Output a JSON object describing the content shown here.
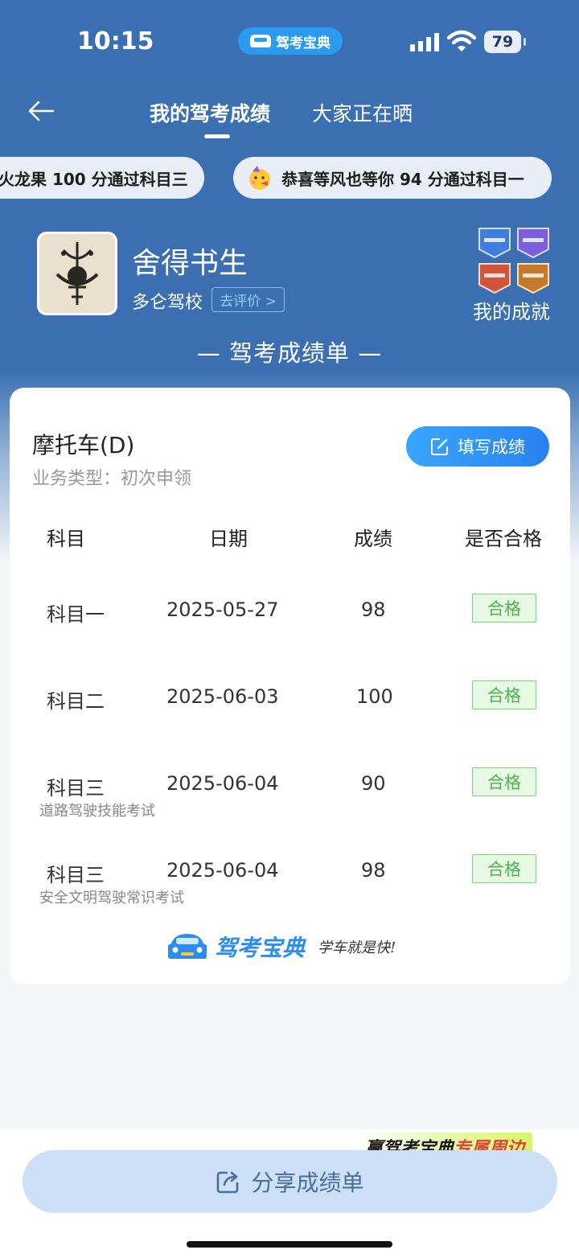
{
  "status_bar": {
    "time": "10:15",
    "app_pill": "驾考宝典",
    "battery": "79"
  },
  "nav": {
    "tabs": [
      {
        "label": "我的驾考成绩",
        "active": true
      },
      {
        "label": "大家正在晒",
        "active": false
      }
    ]
  },
  "ticker": [
    "火龙果 100 分通过科目三",
    "恭喜等风也等你 94 分通过科目一"
  ],
  "profile": {
    "username": "舍得书生",
    "school": "多仑驾校",
    "rate_label": "去评价 >",
    "achievements_label": "我的成就"
  },
  "report_title": "— 驾考成绩单 —",
  "card": {
    "vehicle": "摩托车(D)",
    "business_type": "业务类型：初次申领",
    "fill_button": "填写成绩",
    "columns": [
      "科目",
      "日期",
      "成绩",
      "是否合格"
    ],
    "rows": [
      {
        "subject": "科目一",
        "date": "2025-05-27",
        "score": "98",
        "result": "合格",
        "note": ""
      },
      {
        "subject": "科目二",
        "date": "2025-06-03",
        "score": "100",
        "result": "合格",
        "note": ""
      },
      {
        "subject": "科目三",
        "date": "2025-06-04",
        "score": "90",
        "result": "合格",
        "note": "道路驾驶技能考试"
      },
      {
        "subject": "科目三",
        "date": "2025-06-04",
        "score": "98",
        "result": "合格",
        "note": "安全文明驾驶常识考试"
      }
    ],
    "brand_name": "驾考宝典",
    "brand_slogan": "学车就是快!"
  },
  "merch_banner": {
    "prefix": "赢驾考宝典",
    "highlight": "专属周边"
  },
  "share_button": "分享成绩单",
  "colors": {
    "header": "#3a6fb3",
    "primary": "#2a8ef0",
    "pass_green": "#4bb54e",
    "share_bg": "#cde0f7"
  }
}
